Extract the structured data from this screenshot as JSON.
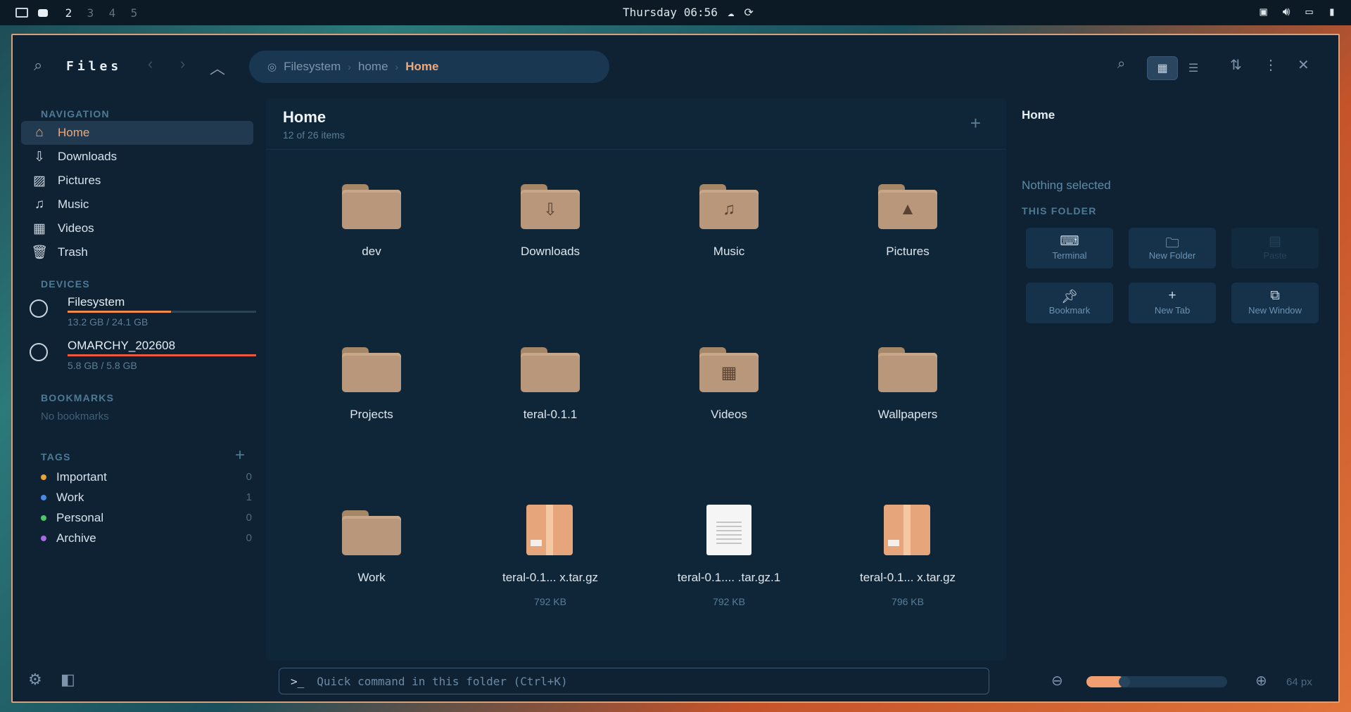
{
  "topbar": {
    "workspaces": [
      "2",
      "3",
      "4",
      "5"
    ],
    "clock": "Thursday 06:56"
  },
  "window": {
    "title": "Files",
    "breadcrumb": [
      "Filesystem",
      "home",
      "Home"
    ]
  },
  "sidebar": {
    "navigation_title": "NAVIGATION",
    "nav": [
      {
        "label": "Home",
        "icon": "home-icon"
      },
      {
        "label": "Downloads",
        "icon": "download-icon"
      },
      {
        "label": "Pictures",
        "icon": "image-icon"
      },
      {
        "label": "Music",
        "icon": "music-icon"
      },
      {
        "label": "Videos",
        "icon": "film-icon"
      },
      {
        "label": "Trash",
        "icon": "trash-icon"
      }
    ],
    "devices_title": "DEVICES",
    "devices": [
      {
        "name": "Filesystem",
        "size": "13.2 GB / 24.1 GB",
        "usage": 0.55,
        "color": "#f08a4a"
      },
      {
        "name": "OMARCHY_202608",
        "size": "5.8 GB / 5.8 GB",
        "usage": 1.0,
        "color": "#e85a3a"
      }
    ],
    "bookmarks_title": "BOOKMARKS",
    "bookmarks_empty": "No bookmarks",
    "tags_title": "TAGS",
    "tags": [
      {
        "label": "Important",
        "count": "0",
        "color": "#e8a23a"
      },
      {
        "label": "Work",
        "count": "1",
        "color": "#4a8ae8"
      },
      {
        "label": "Personal",
        "count": "0",
        "color": "#4ac86a"
      },
      {
        "label": "Archive",
        "count": "0",
        "color": "#a868e0"
      }
    ]
  },
  "main": {
    "title": "Home",
    "subtitle": "12 of 26 items",
    "items": [
      {
        "label": "dev",
        "kind": "folder",
        "glyph": ""
      },
      {
        "label": "Downloads",
        "kind": "folder",
        "glyph": "⇩"
      },
      {
        "label": "Music",
        "kind": "folder",
        "glyph": "♫"
      },
      {
        "label": "Pictures",
        "kind": "folder",
        "glyph": "▲"
      },
      {
        "label": "Projects",
        "kind": "folder",
        "glyph": ""
      },
      {
        "label": "teral-0.1.1",
        "kind": "folder",
        "glyph": ""
      },
      {
        "label": "Videos",
        "kind": "folder",
        "glyph": "▦"
      },
      {
        "label": "Wallpapers",
        "kind": "folder",
        "glyph": ""
      },
      {
        "label": "Work",
        "kind": "folder",
        "glyph": ""
      },
      {
        "label": "teral-0.1... x.tar.gz",
        "kind": "package",
        "size": "792 KB"
      },
      {
        "label": "teral-0.1.... .tar.gz.1",
        "kind": "document",
        "size": "792 KB"
      },
      {
        "label": "teral-0.1... x.tar.gz",
        "kind": "package",
        "size": "796 KB"
      }
    ]
  },
  "details": {
    "title": "Home",
    "empty": "Nothing selected",
    "section": "THIS FOLDER",
    "actions": [
      {
        "label": "Terminal",
        "icon": "terminal-icon",
        "enabled": true
      },
      {
        "label": "New Folder",
        "icon": "new-folder-icon",
        "enabled": true
      },
      {
        "label": "Paste",
        "icon": "paste-icon",
        "enabled": false
      },
      {
        "label": "Bookmark",
        "icon": "pin-icon",
        "enabled": true
      },
      {
        "label": "New Tab",
        "icon": "plus-icon",
        "enabled": true
      },
      {
        "label": "New Window",
        "icon": "window-icon",
        "enabled": true
      }
    ]
  },
  "footer": {
    "command_prompt": ">_",
    "command_placeholder": "Quick command in this folder (Ctrl+K)",
    "zoom_label": "64 px",
    "zoom_level": 0.27
  }
}
